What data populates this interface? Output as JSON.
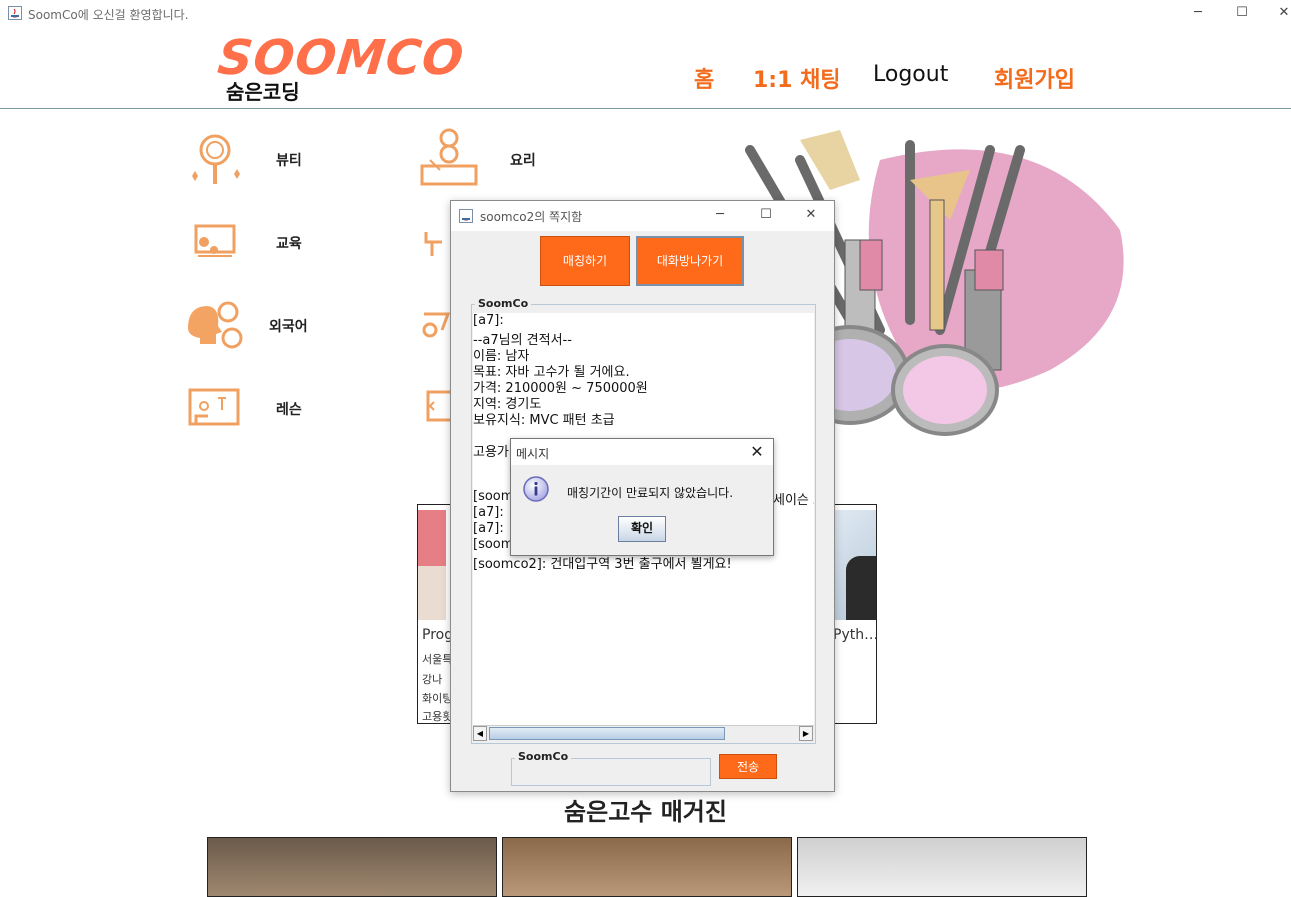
{
  "window": {
    "title": "SoomCo에 오신걸 환영합니다.",
    "controls": [
      "─",
      "☐",
      "✕"
    ]
  },
  "header": {
    "logo_text": "SOOMCO",
    "logo_subtext": "숨은코딩",
    "nav": [
      {
        "label": "홈",
        "color": "#f36b1c"
      },
      {
        "label": "1:1 채팅",
        "color": "#f36b1c"
      },
      {
        "label": "Logout",
        "color": "#111111"
      },
      {
        "label": "회원가입",
        "color": "#f36b1c"
      }
    ]
  },
  "categories": {
    "left": [
      {
        "label": "뷰티",
        "icon": "mirror-icon"
      },
      {
        "label": "교육",
        "icon": "classroom-icon"
      },
      {
        "label": "외국어",
        "icon": "speaking-head-icon"
      },
      {
        "label": "레슨",
        "icon": "presentation-icon"
      }
    ],
    "right": [
      {
        "label": "요리",
        "icon": "chef-icon"
      }
    ]
  },
  "cards": {
    "left_card": {
      "title": "Prog",
      "lines": [
        "서울특",
        "강나",
        "화이팅",
        "고용횟"
      ]
    },
    "right_card": {
      "title": "Pyth…"
    }
  },
  "magazine": {
    "title": "숨은고수 매거진"
  },
  "chat_window": {
    "title": "soomco2의 쪽지함",
    "match_button": "매칭하기",
    "leave_button": "대화방나가기",
    "panel_label": "SoomCo",
    "lines": [
      "[a7]:",
      "--a7님의 견적서--",
      "이름: 남자",
      "목표: 자바 고수가 될 거에요.",
      "가격: 210000원 ~ 750000원",
      "지역: 경기도",
      "보유지식: MVC 패턴 초급",
      "",
      "고용가",
      "",
      "",
      "[soom",
      "[a7]:",
      "[a7]:",
      "[soom",
      "[soomco2]: 건대입구역 3번 출구에서 뵐게요!"
    ],
    "hidden_right_text": "세이슨 고",
    "input_label": "SoomCo",
    "send_button": "전송"
  },
  "message_dialog": {
    "title": "메시지",
    "message": "매칭기간이 만료되지 않았습니다.",
    "ok_button": "확인"
  },
  "colors": {
    "accent": "#ff6a1a",
    "nav_orange": "#f36b1c",
    "logo_orange": "#ff6f4a"
  }
}
